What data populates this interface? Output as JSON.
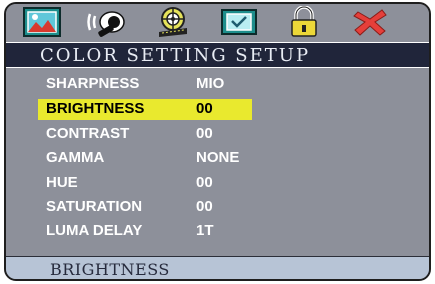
{
  "icons": [
    {
      "name": "picture-icon"
    },
    {
      "name": "audio-icon"
    },
    {
      "name": "film-reel-icon"
    },
    {
      "name": "preferences-icon"
    },
    {
      "name": "lock-icon"
    },
    {
      "name": "exit-icon"
    }
  ],
  "menu": {
    "title": "COLOR SETTING SETUP",
    "items": [
      {
        "label": "SHARPNESS",
        "value": "MIO"
      },
      {
        "label": "BRIGHTNESS",
        "value": "00",
        "selected": true
      },
      {
        "label": "CONTRAST",
        "value": "00"
      },
      {
        "label": "GAMMA",
        "value": "NONE"
      },
      {
        "label": "HUE",
        "value": "00"
      },
      {
        "label": "SATURATION",
        "value": "00"
      },
      {
        "label": "LUMA DELAY",
        "value": "1T"
      }
    ]
  },
  "status": {
    "text": "BRIGHTNESS"
  },
  "colors": {
    "frame_bg": "#8d909a",
    "title_bg": "#20253a",
    "highlight": "#e9e92e",
    "status_bg": "#b7c4d6",
    "icon_teal": "#1e8e8c",
    "exit_red": "#e53f3a"
  }
}
